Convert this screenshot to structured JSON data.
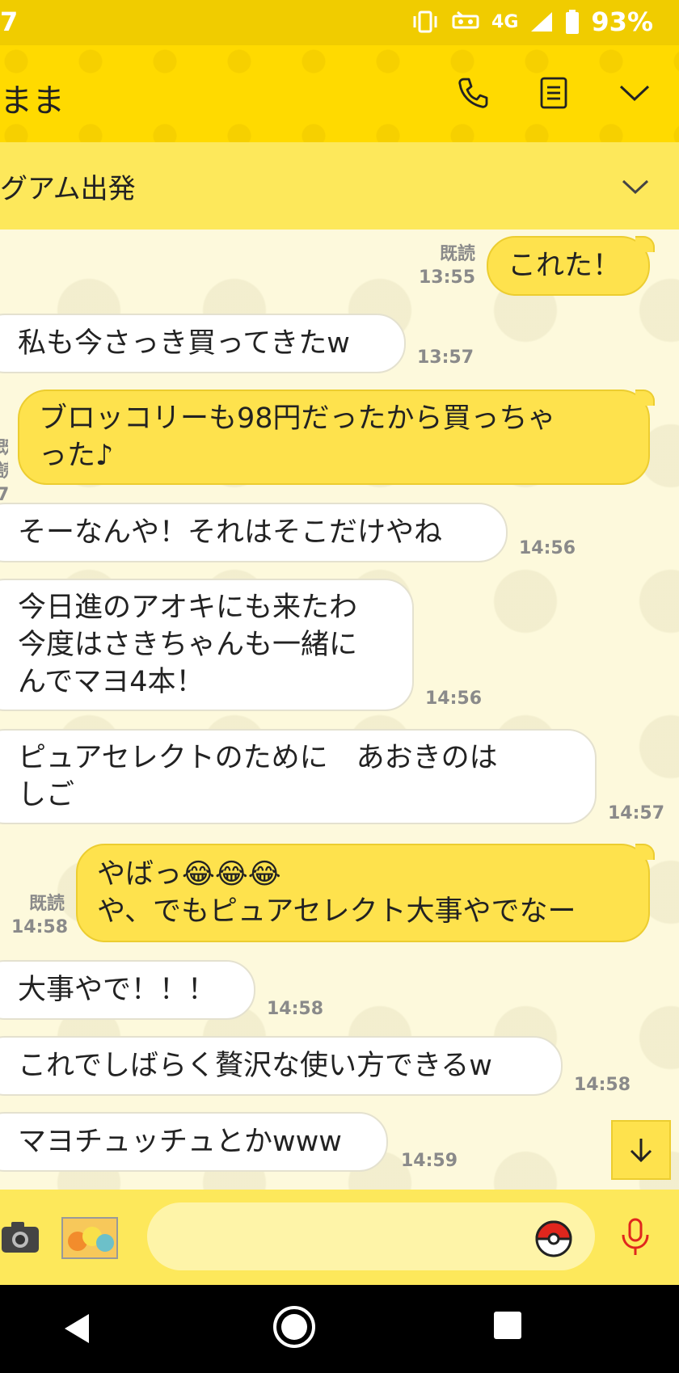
{
  "status_bar": {
    "left_text": "7",
    "network": "4G",
    "battery": "93%"
  },
  "header": {
    "title": "まま"
  },
  "notice": {
    "text": "グアム出発"
  },
  "messages": [
    {
      "side": "out",
      "text": "これた！",
      "read": "既読",
      "time": "13:55"
    },
    {
      "side": "in",
      "text": "私も今さっき買ってきたw",
      "time": "13:57"
    },
    {
      "side": "out",
      "text": "ブロッコリーも98円だったから買っちゃ\nった♪",
      "read": "既読",
      "time": "7"
    },
    {
      "side": "in",
      "text": "そーなんや！それはそこだけやね",
      "time": "14:56"
    },
    {
      "side": "in",
      "text": "今日進のアオキにも来たわ\n今度はさきちゃんも一緒に\nんでマヨ4本！",
      "time": "14:56"
    },
    {
      "side": "in",
      "text": "ピュアセレクトのために　あおきのは\nしご",
      "time": "14:57"
    },
    {
      "side": "out",
      "text": "やばっ😂😂😂\nや、でもピュアセレクト大事やでなー",
      "read": "既読",
      "time": "14:58"
    },
    {
      "side": "in",
      "text": "大事やで！！！",
      "time": "14:58"
    },
    {
      "side": "in",
      "text": "これでしばらく贅沢な使い方できるw",
      "time": "14:58"
    },
    {
      "side": "in",
      "text": "マヨチュッチュとかwww",
      "time": "14:59"
    }
  ]
}
